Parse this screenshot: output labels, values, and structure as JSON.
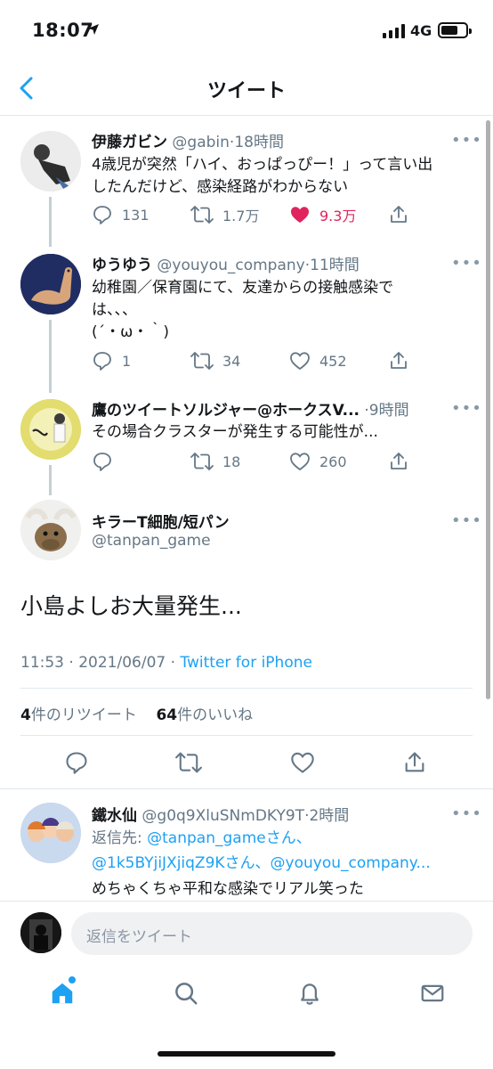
{
  "status_bar": {
    "time": "18:07",
    "network": "4G"
  },
  "nav": {
    "title": "ツイート"
  },
  "tweets": [
    {
      "name": "伊藤ガビン",
      "handle": "@gabin",
      "separator": "·",
      "ago": "18時間",
      "text_lines": [
        "4歳児が突然「ハイ、おっぱっぴー！」って言い出",
        "したんだけど、感染経路がわからない"
      ],
      "replies": "131",
      "retweets": "1.7万",
      "likes": "9.3万",
      "liked": true
    },
    {
      "name": "ゆうゆう",
      "handle": "@youyou_company",
      "separator": "·",
      "ago": "11時間",
      "text_lines": [
        "幼稚園／保育園にて、友達からの接触感染で",
        "は、、、",
        "(´・ω・｀)"
      ],
      "replies": "1",
      "retweets": "34",
      "likes": "452",
      "liked": false
    },
    {
      "name": "鷹のツイートソルジャー@ホークスV...",
      "handle": "",
      "separator": "·",
      "ago": "9時間",
      "text_lines": [
        "その場合クラスターが発生する可能性が..."
      ],
      "replies": "",
      "retweets": "18",
      "likes": "260",
      "liked": false
    }
  ],
  "main_tweet": {
    "name": "キラーT細胞/短パン",
    "handle": "@tanpan_game",
    "text": "小島よしお大量発生...",
    "time": "11:53",
    "separator": "·",
    "date": "2021/06/07",
    "separator2": "·",
    "client": "Twitter for iPhone",
    "retweet_count": "4",
    "retweet_label": "件のリツイート",
    "like_count": "64",
    "like_label": "件のいいね"
  },
  "reply_tweet": {
    "name": "鐵水仙",
    "handle": "@g0q9XluSNmDKY9T",
    "separator": "·",
    "ago": "2時間",
    "reply_prefix": "返信先: ",
    "reply_targets_line1": "@tanpan_gameさん、",
    "reply_targets_line2": "@1k5BYjiJXjiqZ9Kさん、@youyou_company...",
    "text": "めちゃくちゃ平和な感染でリアル笑った"
  },
  "composer": {
    "placeholder": "返信をツイート"
  },
  "more_glyph": "•••",
  "colors": {
    "accent": "#1da1f2",
    "like": "#e0245e",
    "secondary_text": "#657786",
    "divider": "#e1e8ed"
  },
  "icons": [
    "back-chevron-icon",
    "reply-icon",
    "retweet-icon",
    "heart-icon",
    "share-icon",
    "home-icon",
    "search-icon",
    "bell-icon",
    "mail-icon"
  ]
}
